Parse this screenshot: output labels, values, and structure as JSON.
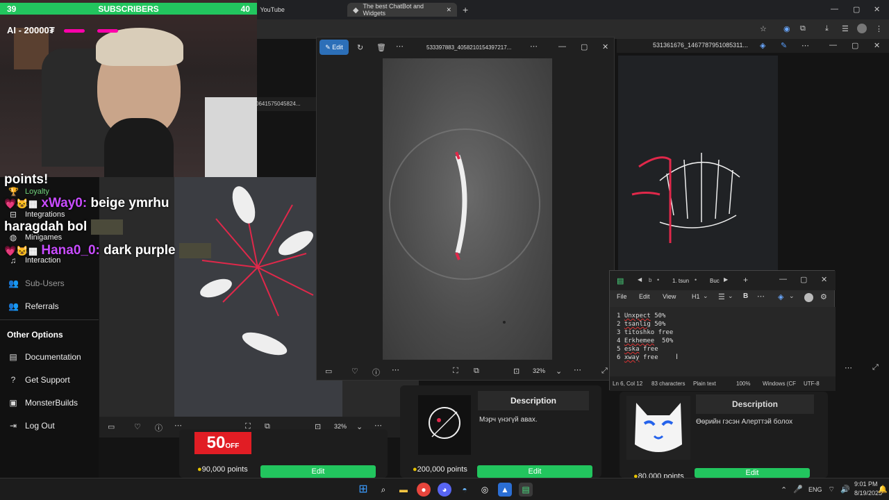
{
  "browser": {
    "tabs": [
      {
        "title": "YouTube"
      },
      {
        "title": "The best ChatBot and Widgets"
      }
    ]
  },
  "stream": {
    "subscribers_left": "39",
    "subscribers_label": "SUBSCRIBERS",
    "subscribers_right": "40",
    "ai_label": "AI - 20000₮"
  },
  "chat": [
    {
      "prefix": "points!",
      "user": "",
      "message": ""
    },
    {
      "prefix": "",
      "user": "xWay0:",
      "message": "beige ymrhu"
    },
    {
      "prefix": "haragdah bol",
      "user": "",
      "message": ""
    },
    {
      "prefix": "",
      "user": "Hana0_0:",
      "message": "dark purple"
    }
  ],
  "sidebar": {
    "items": [
      {
        "label": "Loyalty",
        "icon": "trophy-icon"
      },
      {
        "label": "Integrations",
        "icon": "plug-icon"
      },
      {
        "label": "Minigames",
        "icon": "gamepad-icon"
      },
      {
        "label": "Interaction",
        "icon": "music-icon"
      },
      {
        "label": "Sub-Users",
        "icon": "users-icon"
      },
      {
        "label": "Referrals",
        "icon": "referral-icon"
      }
    ],
    "other_options_heading": "Other Options",
    "other_items": [
      {
        "label": "Documentation",
        "icon": "doc-icon"
      },
      {
        "label": "Get Support",
        "icon": "help-icon"
      },
      {
        "label": "MonsterBuilds",
        "icon": "monitor-icon"
      },
      {
        "label": "Log Out",
        "icon": "logout-icon"
      }
    ]
  },
  "viewer_back": {
    "filename": "0641575045824...",
    "zoom": "32%"
  },
  "viewer_main": {
    "edit_label": "Edit",
    "filename": "533397883_4058210154397217...",
    "zoom": "32%"
  },
  "viewer_right": {
    "filename": "531361676_1467787951085311..."
  },
  "notepad": {
    "tabs": [
      "1. tsun",
      "Buc"
    ],
    "menu": [
      "File",
      "Edit",
      "View"
    ],
    "heading": "H1",
    "lines": [
      {
        "num": "1",
        "name": "Unxpect",
        "value": "50%"
      },
      {
        "num": "2",
        "name": "tsanlig",
        "value": "50%"
      },
      {
        "num": "3",
        "name": "titoshko",
        "value": "free"
      },
      {
        "num": "4",
        "name": "Erkhemee",
        "value": " 50%"
      },
      {
        "num": "5",
        "name": "eska",
        "value": "free"
      },
      {
        "num": "6",
        "name": "xway",
        "value": "free"
      }
    ],
    "status": {
      "position": "Ln 6, Col 12",
      "chars": "83 characters",
      "format": "Plain text",
      "zoom": "100%",
      "line_ending": "Windows (CF",
      "encoding": "UTF-8"
    }
  },
  "cards": [
    {
      "points": "90,000 points",
      "edit": "Edit",
      "sale_badge": "50",
      "sale_off": "OFF"
    },
    {
      "points": "200,000 points",
      "edit": "Edit",
      "heading": "Description",
      "description": "Мэрч үнэгүй авах."
    },
    {
      "points": "80,000 points",
      "edit": "Edit",
      "heading": "Description",
      "description": "Өөрийн гэсэн Алерттэй болох"
    }
  ],
  "taskbar": {
    "lang": "ENG",
    "time": "9:01 PM",
    "date": "8/19/2025"
  },
  "colors": {
    "accent": "#22c55e",
    "username": "#c84cff",
    "edit_button": "#3b82f6"
  }
}
